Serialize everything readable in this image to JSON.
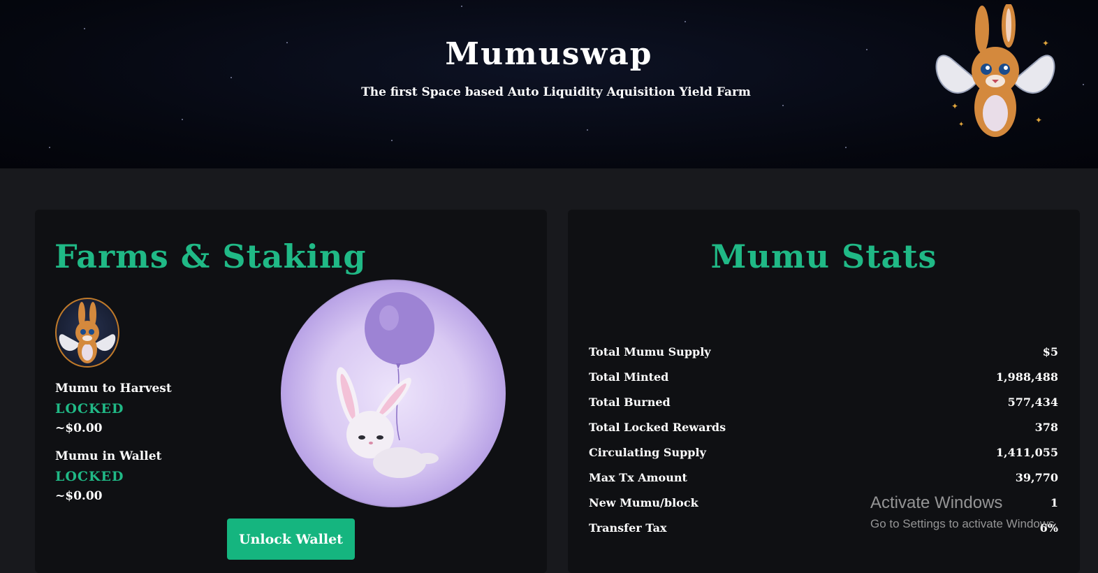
{
  "hero": {
    "title": "Mumuswap",
    "subtitle": "The first Space based Auto Liquidity Aquisition Yield Farm"
  },
  "farms": {
    "title": "Farms & Staking",
    "harvest_label": "Mumu to Harvest",
    "harvest_status": "LOCKED",
    "harvest_usd": "~$0.00",
    "wallet_label": "Mumu in Wallet",
    "wallet_status": "LOCKED",
    "wallet_usd": "~$0.00",
    "unlock_button": "Unlock Wallet"
  },
  "stats": {
    "title": "Mumu Stats",
    "rows": [
      {
        "label": "Total Mumu Supply",
        "value": "$5"
      },
      {
        "label": "Total Minted",
        "value": "1,988,488"
      },
      {
        "label": "Total Burned",
        "value": "577,434"
      },
      {
        "label": "Total Locked Rewards",
        "value": "378"
      },
      {
        "label": "Circulating Supply",
        "value": "1,411,055"
      },
      {
        "label": "Max Tx Amount",
        "value": "39,770"
      },
      {
        "label": "New Mumu/block",
        "value": "1"
      },
      {
        "label": "Transfer Tax",
        "value": "6%"
      }
    ]
  },
  "watermark": {
    "title": "Activate Windows",
    "subtitle": "Go to Settings to activate Windows."
  },
  "colors": {
    "accent": "#20b986",
    "button": "#15b57f",
    "page_bg": "#18191d",
    "card_bg": "#0f1013"
  }
}
